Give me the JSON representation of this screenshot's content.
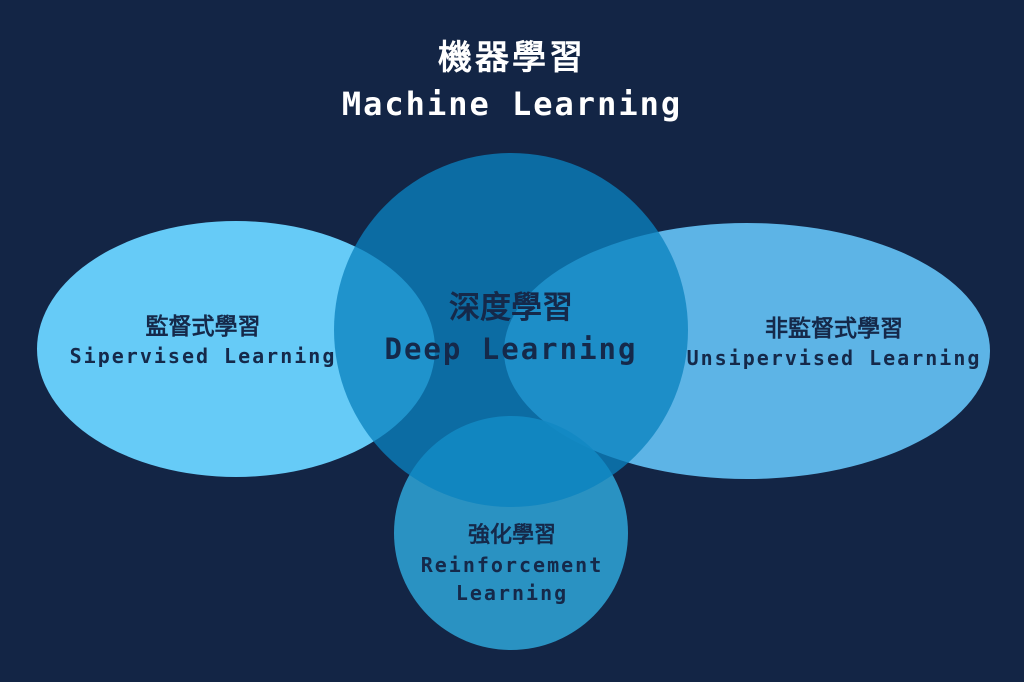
{
  "colors": {
    "background": "#132545",
    "supervised_fill": "#6ad2ff",
    "unsupervised_fill": "#62bdf0",
    "deep_learning_fill": "#0b82bf",
    "reinforcement_fill": "#2d9fcf",
    "title_text": "#ffffff",
    "label_text": "#15294a"
  },
  "title": {
    "zh": "機器學習",
    "en": "Machine Learning"
  },
  "regions": {
    "supervised": {
      "zh": "監督式學習",
      "en": "Sipervised Learning"
    },
    "deep_learning": {
      "zh": "深度學習",
      "en": "Deep Learning"
    },
    "unsupervised": {
      "zh": "非監督式學習",
      "en": "Unsipervised Learning"
    },
    "reinforcement": {
      "zh": "強化學習",
      "en_line1": "Reinforcement",
      "en_line2": "Learning"
    }
  }
}
